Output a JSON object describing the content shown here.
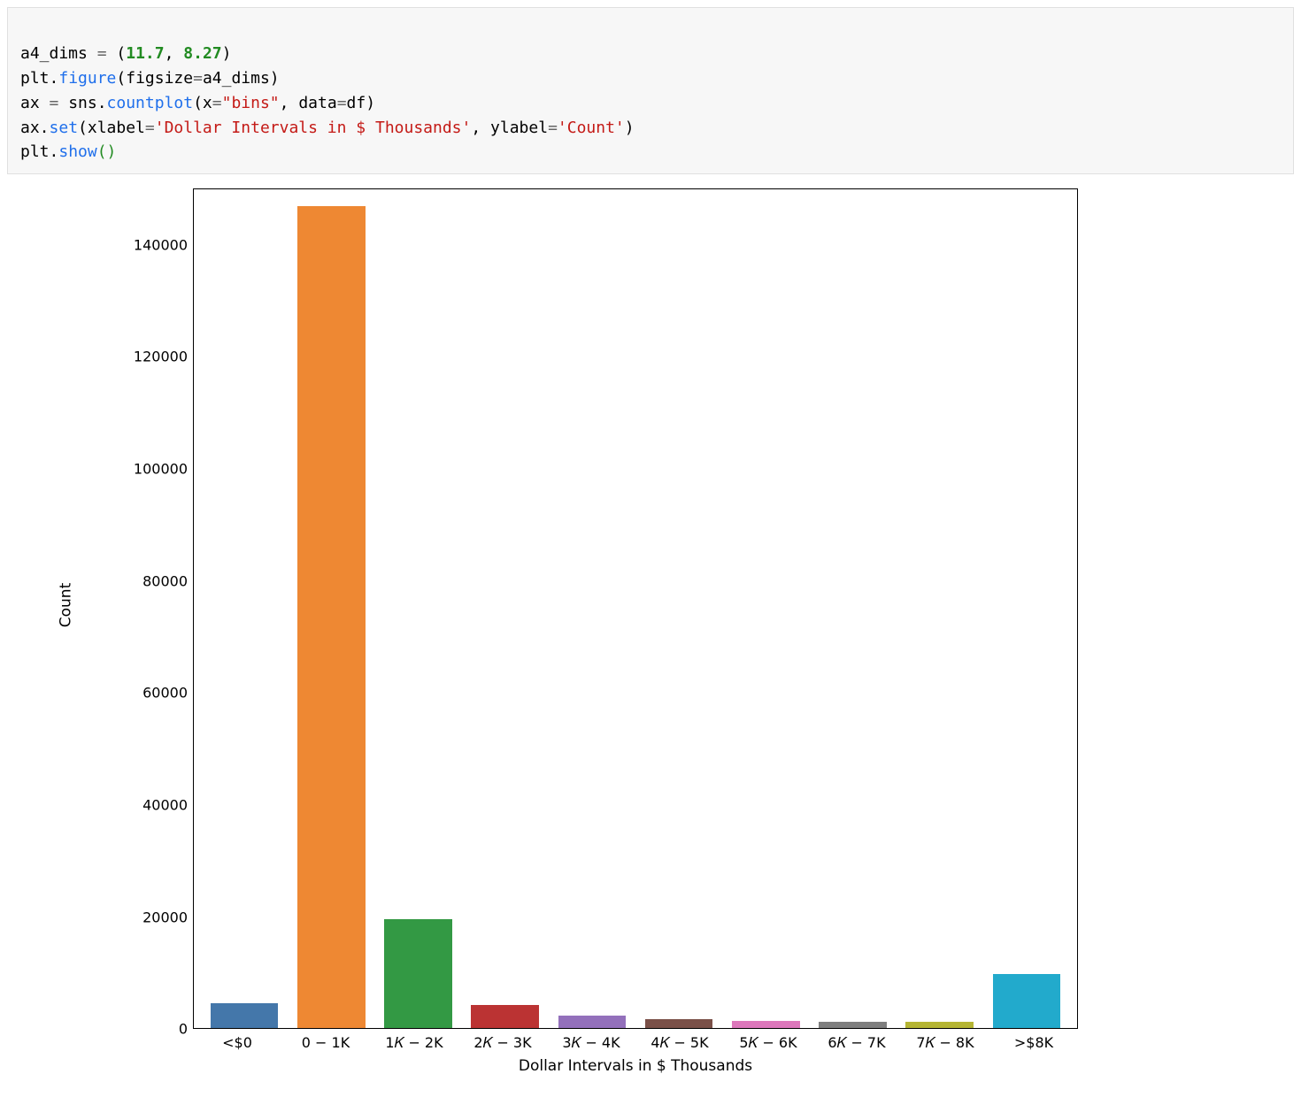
{
  "code": {
    "line1_var": "a4_dims ",
    "line1_eq": "=",
    "line1_open": " (",
    "line1_n1": "11.7",
    "line1_comma": ", ",
    "line1_n2": "8.27",
    "line1_close": ")",
    "line2_pre": "plt.",
    "line2_fn": "figure",
    "line2_args_open": "(figsize",
    "line2_eq": "=",
    "line2_args_close": "a4_dims)",
    "line3_pre": "ax ",
    "line3_eq": "=",
    "line3_mid": " sns.",
    "line3_fn": "countplot",
    "line3_args_open": "(x",
    "line3_eq2": "=",
    "line3_str1": "\"bins\"",
    "line3_comma": ", data",
    "line3_eq3": "=",
    "line3_args_close": "df)",
    "line4_pre": "ax.",
    "line4_fn": "set",
    "line4_args_open": "(xlabel",
    "line4_eq": "=",
    "line4_str1": "'Dollar Intervals in $ Thousands'",
    "line4_mid": ", ylabel",
    "line4_eq2": "=",
    "line4_str2": "'Count'",
    "line4_close": ")",
    "line5_pre": "plt.",
    "line5_fn": "show",
    "line5_paren": "()"
  },
  "chart_data": {
    "type": "bar",
    "xlabel": "Dollar Intervals in $ Thousands",
    "ylabel": "Count",
    "ylim": [
      0,
      150000
    ],
    "yticks": [
      0,
      20000,
      40000,
      60000,
      80000,
      100000,
      120000,
      140000
    ],
    "categories": [
      "<$0",
      "0 − 1K",
      "1𝐾 − 2K",
      "2𝐾 − 3K",
      "3𝐾 − 4K",
      "4𝐾 − 5K",
      "5𝐾 − 6K",
      "6𝐾 − 7K",
      "7𝐾 − 8K",
      ">$8K"
    ],
    "values": [
      4500,
      147000,
      19500,
      4200,
      2200,
      1600,
      1300,
      1200,
      1200,
      9700
    ],
    "colors": [
      "#4477aa",
      "#ee8833",
      "#339944",
      "#bb3333",
      "#9370bb",
      "#7a5048",
      "#dd77bb",
      "#7f7f7f",
      "#b5b533",
      "#22aacc"
    ]
  }
}
